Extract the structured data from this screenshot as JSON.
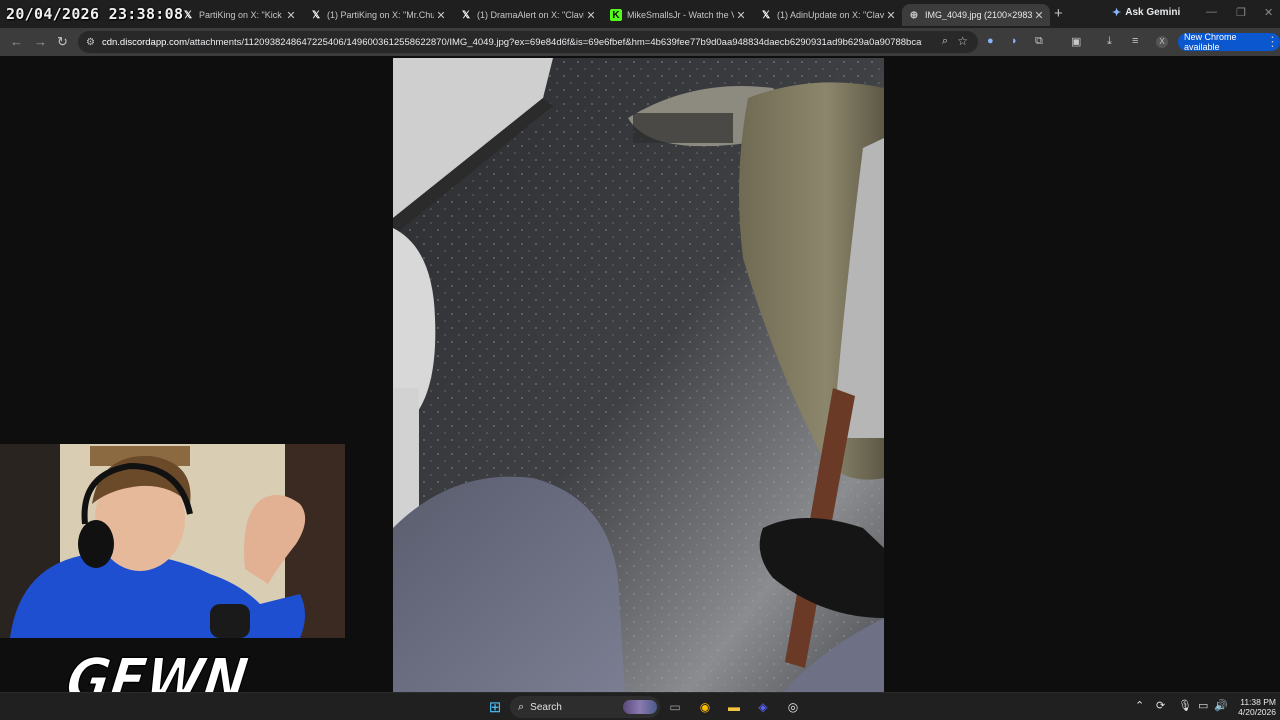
{
  "overlay": {
    "timestamp": "20/04/2026 23:38:08"
  },
  "browser": {
    "tabs": [
      {
        "title": "PartiKing on X: \"Kick stre",
        "favicon": "x-logo-icon"
      },
      {
        "title": "(1) PartiKing on X: \"Mr.Chud",
        "favicon": "x-logo-icon"
      },
      {
        "title": "(1) DramaAlert on X: \"Clavic",
        "favicon": "x-logo-icon"
      },
      {
        "title": "MikeSmallsJr - Watch the V",
        "favicon": "kick-icon"
      },
      {
        "title": "(1) AdinUpdate on X: \"Clavic",
        "favicon": "x-logo-icon"
      },
      {
        "title": "IMG_4049.jpg (2100×2983)",
        "favicon": "globe-icon",
        "active": true
      }
    ],
    "ask_gemini_label": "Ask Gemini",
    "url_host": "cdn.discordapp.com",
    "url_path": "/attachments/1120938248647225406/1496003612558622870/IMG_4049.jpg?ex=69e84d6f&is=69e6fbef&hm=4b639fee77b9d0aa948834daecb6290931ad9b629a0a90788bca90...",
    "new_chrome_label": "New Chrome available",
    "profile_initial": "X"
  },
  "stream": {
    "channel_logo_text": "GEWN"
  },
  "taskbar": {
    "search_label": "Search",
    "time": "11:38 PM",
    "date": "4/20/2026"
  },
  "colors": {
    "tab_strip": "#1f1f1f",
    "toolbar": "#3c3c3c",
    "update_button": "#0b57d0",
    "taskbar": "#202020"
  }
}
